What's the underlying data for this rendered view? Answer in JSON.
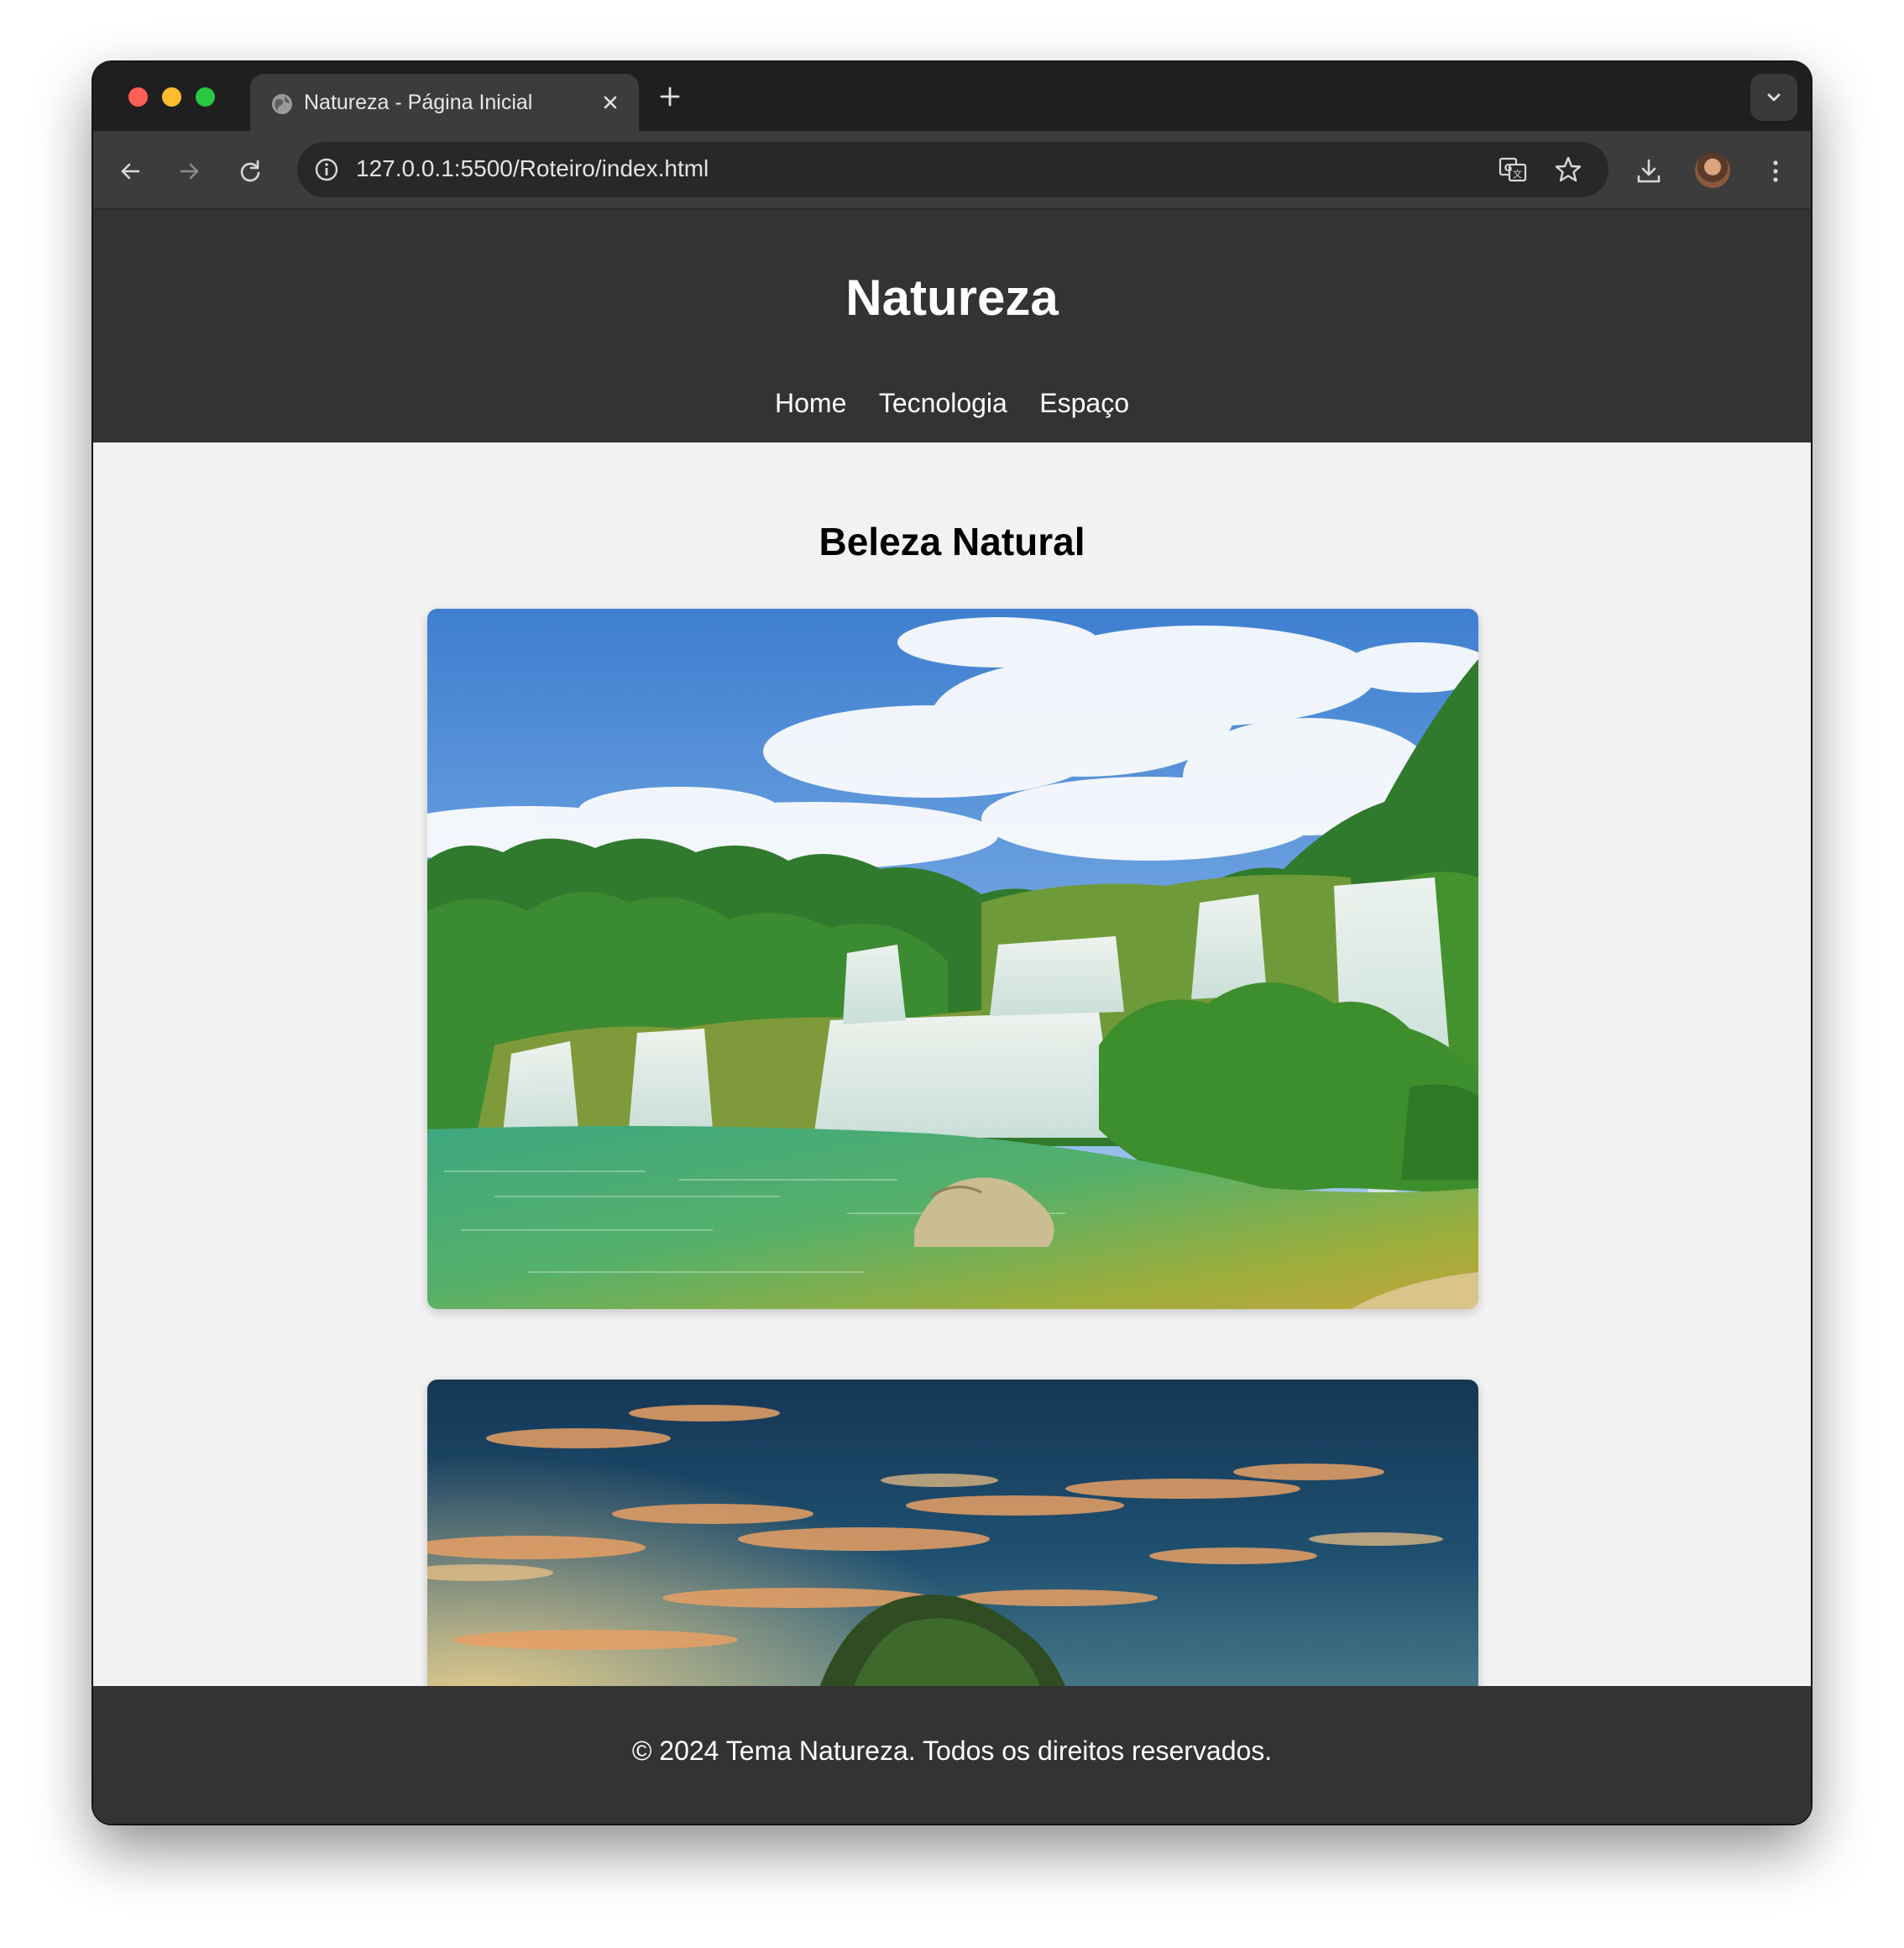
{
  "browser": {
    "tab": {
      "title": "Natureza - Página Inicial"
    },
    "address": {
      "url": "127.0.0.1:5500/Roteiro/index.html"
    },
    "icons": [
      "back-icon",
      "forward-icon",
      "reload-icon",
      "site-info-icon",
      "translate-icon",
      "bookmark-star-icon",
      "download-icon",
      "avatar",
      "more-menu-icon",
      "tab-search-chevron-icon",
      "new-tab-plus-icon",
      "tab-close-icon",
      "globe-favicon-icon"
    ]
  },
  "site": {
    "title": "Natureza",
    "nav": [
      {
        "label": "Home"
      },
      {
        "label": "Tecnologia"
      },
      {
        "label": "Espaço"
      }
    ],
    "section_title": "Beleza Natural",
    "images": [
      "waterfall-landscape-image",
      "sunset-tree-image"
    ],
    "footer": "© 2024 Tema Natureza. Todos os direitos reservados."
  },
  "colors": {
    "header_bg": "#333333",
    "page_bg": "#f2f2f2",
    "footer_bg": "#333333"
  }
}
